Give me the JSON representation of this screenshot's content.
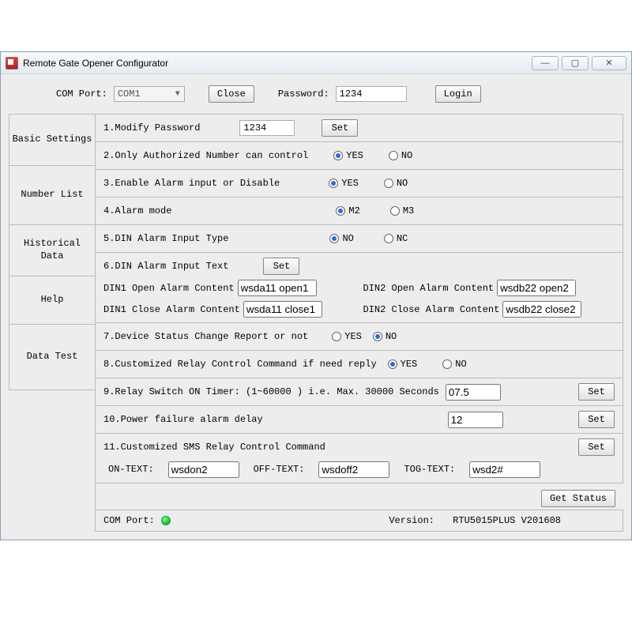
{
  "window": {
    "title": "Remote Gate Opener Configurator"
  },
  "top": {
    "com_port_label": "COM Port:",
    "com_port_value": "COM1",
    "close_label": "Close",
    "password_label": "Password:",
    "password_value": "1234",
    "login_label": "Login"
  },
  "sidebar": {
    "basic": "Basic Settings",
    "numbers": "Number List",
    "history": "Historical Data",
    "help": "Help",
    "datatest": "Data Test"
  },
  "rows": {
    "r1": {
      "label": "1.Modify Password",
      "value": "1234",
      "set": "Set"
    },
    "r2": {
      "label": "2.Only Authorized Number can control",
      "yes": "YES",
      "no": "NO"
    },
    "r3": {
      "label": "3.Enable Alarm input or Disable",
      "yes": "YES",
      "no": "NO"
    },
    "r4": {
      "label": "4.Alarm mode",
      "a": "M2",
      "b": "M3"
    },
    "r5": {
      "label": "5.DIN Alarm Input Type",
      "a": "NO",
      "b": "NC"
    },
    "r6": {
      "label": "6.DIN Alarm Input Text",
      "set": "Set",
      "d1o_l": "DIN1 Open Alarm Content",
      "d1o_v": "wsda11 open1",
      "d1c_l": "DIN1 Close Alarm Content",
      "d1c_v": "wsda11 close1",
      "d2o_l": "DIN2 Open Alarm Content",
      "d2o_v": "wsdb22 open2",
      "d2c_l": "DIN2 Close Alarm Content",
      "d2c_v": "wsdb22 close2"
    },
    "r7": {
      "label": "7.Device Status Change Report or not",
      "yes": "YES",
      "no": "NO"
    },
    "r8": {
      "label": "8.Customized Relay Control Command if need reply",
      "yes": "YES",
      "no": "NO"
    },
    "r9": {
      "label": "9.Relay Switch ON Timer: (1~60000 )  i.e. Max. 30000 Seconds",
      "value": "07.5",
      "set": "Set"
    },
    "r10": {
      "label": "10.Power failure alarm delay",
      "value": "12",
      "set": "Set"
    },
    "r11": {
      "label": "11.Customized SMS Relay Control Command",
      "set": "Set",
      "on_l": "ON-TEXT:",
      "on_v": "wsdon2",
      "off_l": "OFF-TEXT:",
      "off_v": "wsdoff2",
      "tog_l": "TOG-TEXT:",
      "tog_v": "wsd2#"
    }
  },
  "getstatus": "Get Status",
  "status": {
    "com_label": "COM Port:",
    "version_label": "Version:",
    "version_value": "RTU5015PLUS V201608"
  }
}
